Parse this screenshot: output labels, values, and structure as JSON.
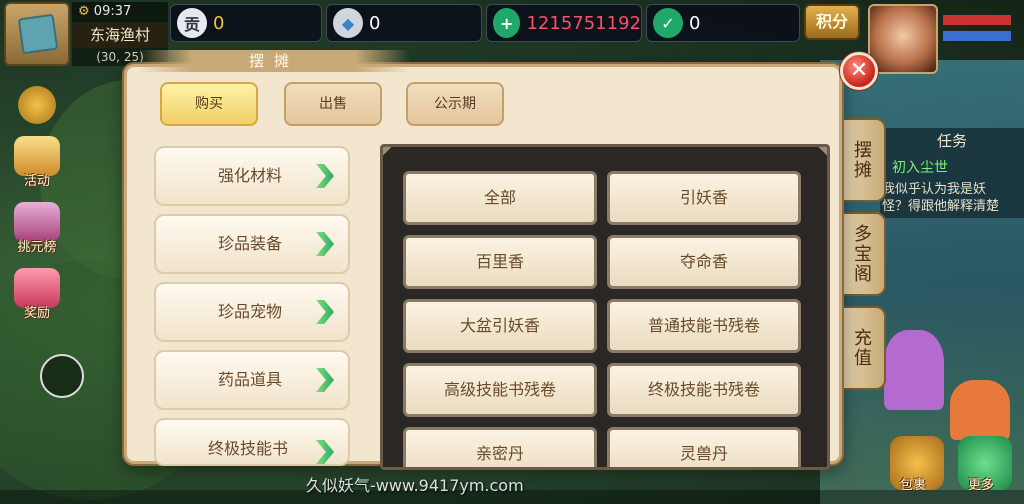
{
  "hud": {
    "time": "09:37",
    "location": "东海渔村",
    "coords": "(30, 25)",
    "currencies": [
      {
        "icon": "tribute-icon",
        "glyph": "贡",
        "value": "0",
        "color": "#f0c14a"
      },
      {
        "icon": "silver-ingot-icon",
        "glyph": "◆",
        "value": "0",
        "color": "#ffffff"
      },
      {
        "icon": "jade-coin-add-icon",
        "glyph": "+",
        "value": "1215751192",
        "color": "#ff4d6d"
      },
      {
        "icon": "jade-coin-locked-icon",
        "glyph": "✓",
        "value": "0",
        "color": "#ffffff"
      }
    ],
    "score_label": "积分"
  },
  "left_buttons": [
    {
      "name": "activity",
      "label": "活动"
    },
    {
      "name": "challenge-ranking",
      "label": "挑元榜"
    },
    {
      "name": "reward",
      "label": "奖励"
    }
  ],
  "task": {
    "title": "任务",
    "name": "初入尘世",
    "desc_line1": "我似乎认为我是妖",
    "desc_line2": "怪？得跟他解释清楚"
  },
  "side_tabs": [
    "摆摊",
    "多宝阁",
    "充值"
  ],
  "dialog": {
    "title": "摆摊",
    "tabs": [
      {
        "label": "购买",
        "active": true
      },
      {
        "label": "出售",
        "active": false
      },
      {
        "label": "公示期",
        "active": false
      }
    ],
    "categories": [
      "强化材料",
      "珍品装备",
      "珍品宠物",
      "药品道具",
      "终极技能书"
    ],
    "items": [
      "全部",
      "引妖香",
      "百里香",
      "夺命香",
      "大盆引妖香",
      "普通技能书残卷",
      "高级技能书残卷",
      "终极技能书残卷",
      "亲密丹",
      "灵兽丹"
    ]
  },
  "bottom_right": {
    "bag_label": "包裹",
    "more_label": "更多"
  },
  "watermark": "久似妖气-www.9417ym.com",
  "colors": {
    "accent_gold": "#f0cf66",
    "arrow_green": "#2aa86a",
    "close_red": "#c8231a"
  }
}
